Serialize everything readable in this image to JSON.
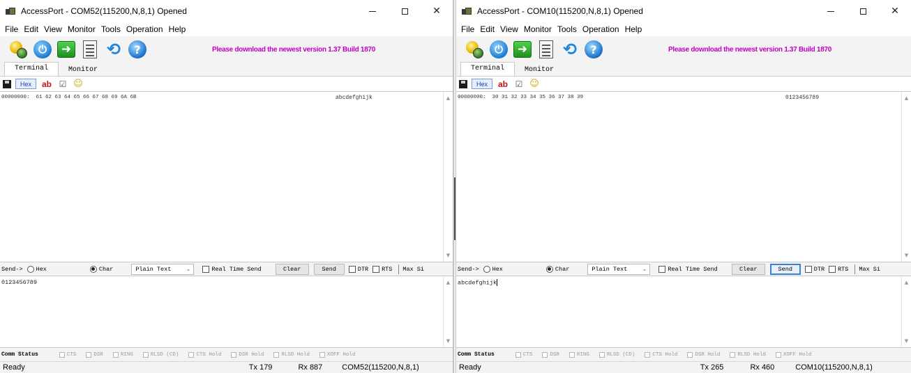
{
  "menus": [
    "File",
    "Edit",
    "View",
    "Monitor",
    "Tools",
    "Operation",
    "Help"
  ],
  "promo_text": "Please download the newest version 1.37 Build 1870",
  "tabs": [
    "Terminal",
    "Monitor"
  ],
  "subtoolbar": {
    "hex_label": "Hex",
    "ab_label": "ab"
  },
  "send_bar": {
    "send_prefix": "Send->",
    "hex_option": "Hex",
    "char_option": "Char",
    "format_value": "Plain Text",
    "realtime_label": "Real Time Send",
    "clear_label": "Clear",
    "send_label": "Send",
    "dtr_label": "DTR",
    "rts_label": "RTS",
    "max_size_label": "Max Si"
  },
  "comm_bar": {
    "label": "Comm Status",
    "signals": [
      "CTS",
      "DSR",
      "RING",
      "RLSD (CD)",
      "CTS Hold",
      "DSR Hold",
      "RLSD Hold",
      "XOFF Hold"
    ]
  },
  "windows": [
    {
      "title": "AccessPort - COM52(115200,N,8,1) Opened",
      "recv_line": "00000000:  61 62 63 64 65 66 67 68 69 6A 6B",
      "recv_ascii": "abcdefghijk",
      "send_text": "0123456789",
      "status": {
        "state": "Ready",
        "tx": "Tx 179",
        "rx": "Rx 887",
        "port": "COM52(115200,N,8,1)"
      }
    },
    {
      "title": "AccessPort - COM10(115200,N,8,1) Opened",
      "recv_line": "00000000:  30 31 32 33 34 35 36 37 38 39",
      "recv_ascii": "0123456789",
      "send_text": "abcdefghijk",
      "status": {
        "state": "Ready",
        "tx": "Tx 265",
        "rx": "Rx 460",
        "port": "COM10(115200,N,8,1)"
      }
    }
  ]
}
